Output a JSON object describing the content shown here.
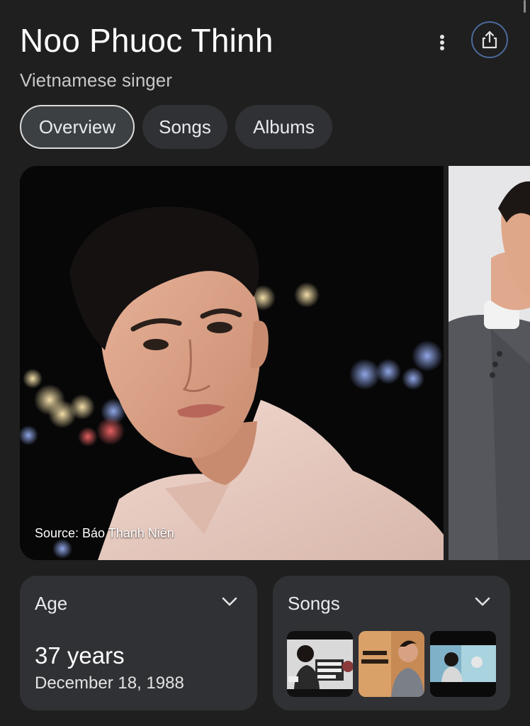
{
  "entity": {
    "name": "Noo Phuoc Thinh",
    "description": "Vietnamese singer"
  },
  "icons": {
    "menu": "more-vert-icon",
    "share": "share-icon",
    "expand": "chevron-down-icon"
  },
  "tabs": [
    {
      "label": "Overview",
      "active": true
    },
    {
      "label": "Songs",
      "active": false
    },
    {
      "label": "Albums",
      "active": false
    }
  ],
  "gallery": {
    "caption": "Source: Báo Thanh Niên"
  },
  "cards": {
    "age": {
      "title": "Age",
      "value": "37 years",
      "birth_date": "December 18, 1988"
    },
    "songs": {
      "title": "Songs"
    }
  },
  "colors": {
    "background": "#1f1f1f",
    "chip": "#303134",
    "card": "#303134",
    "share_ring": "#4b6a9a"
  }
}
